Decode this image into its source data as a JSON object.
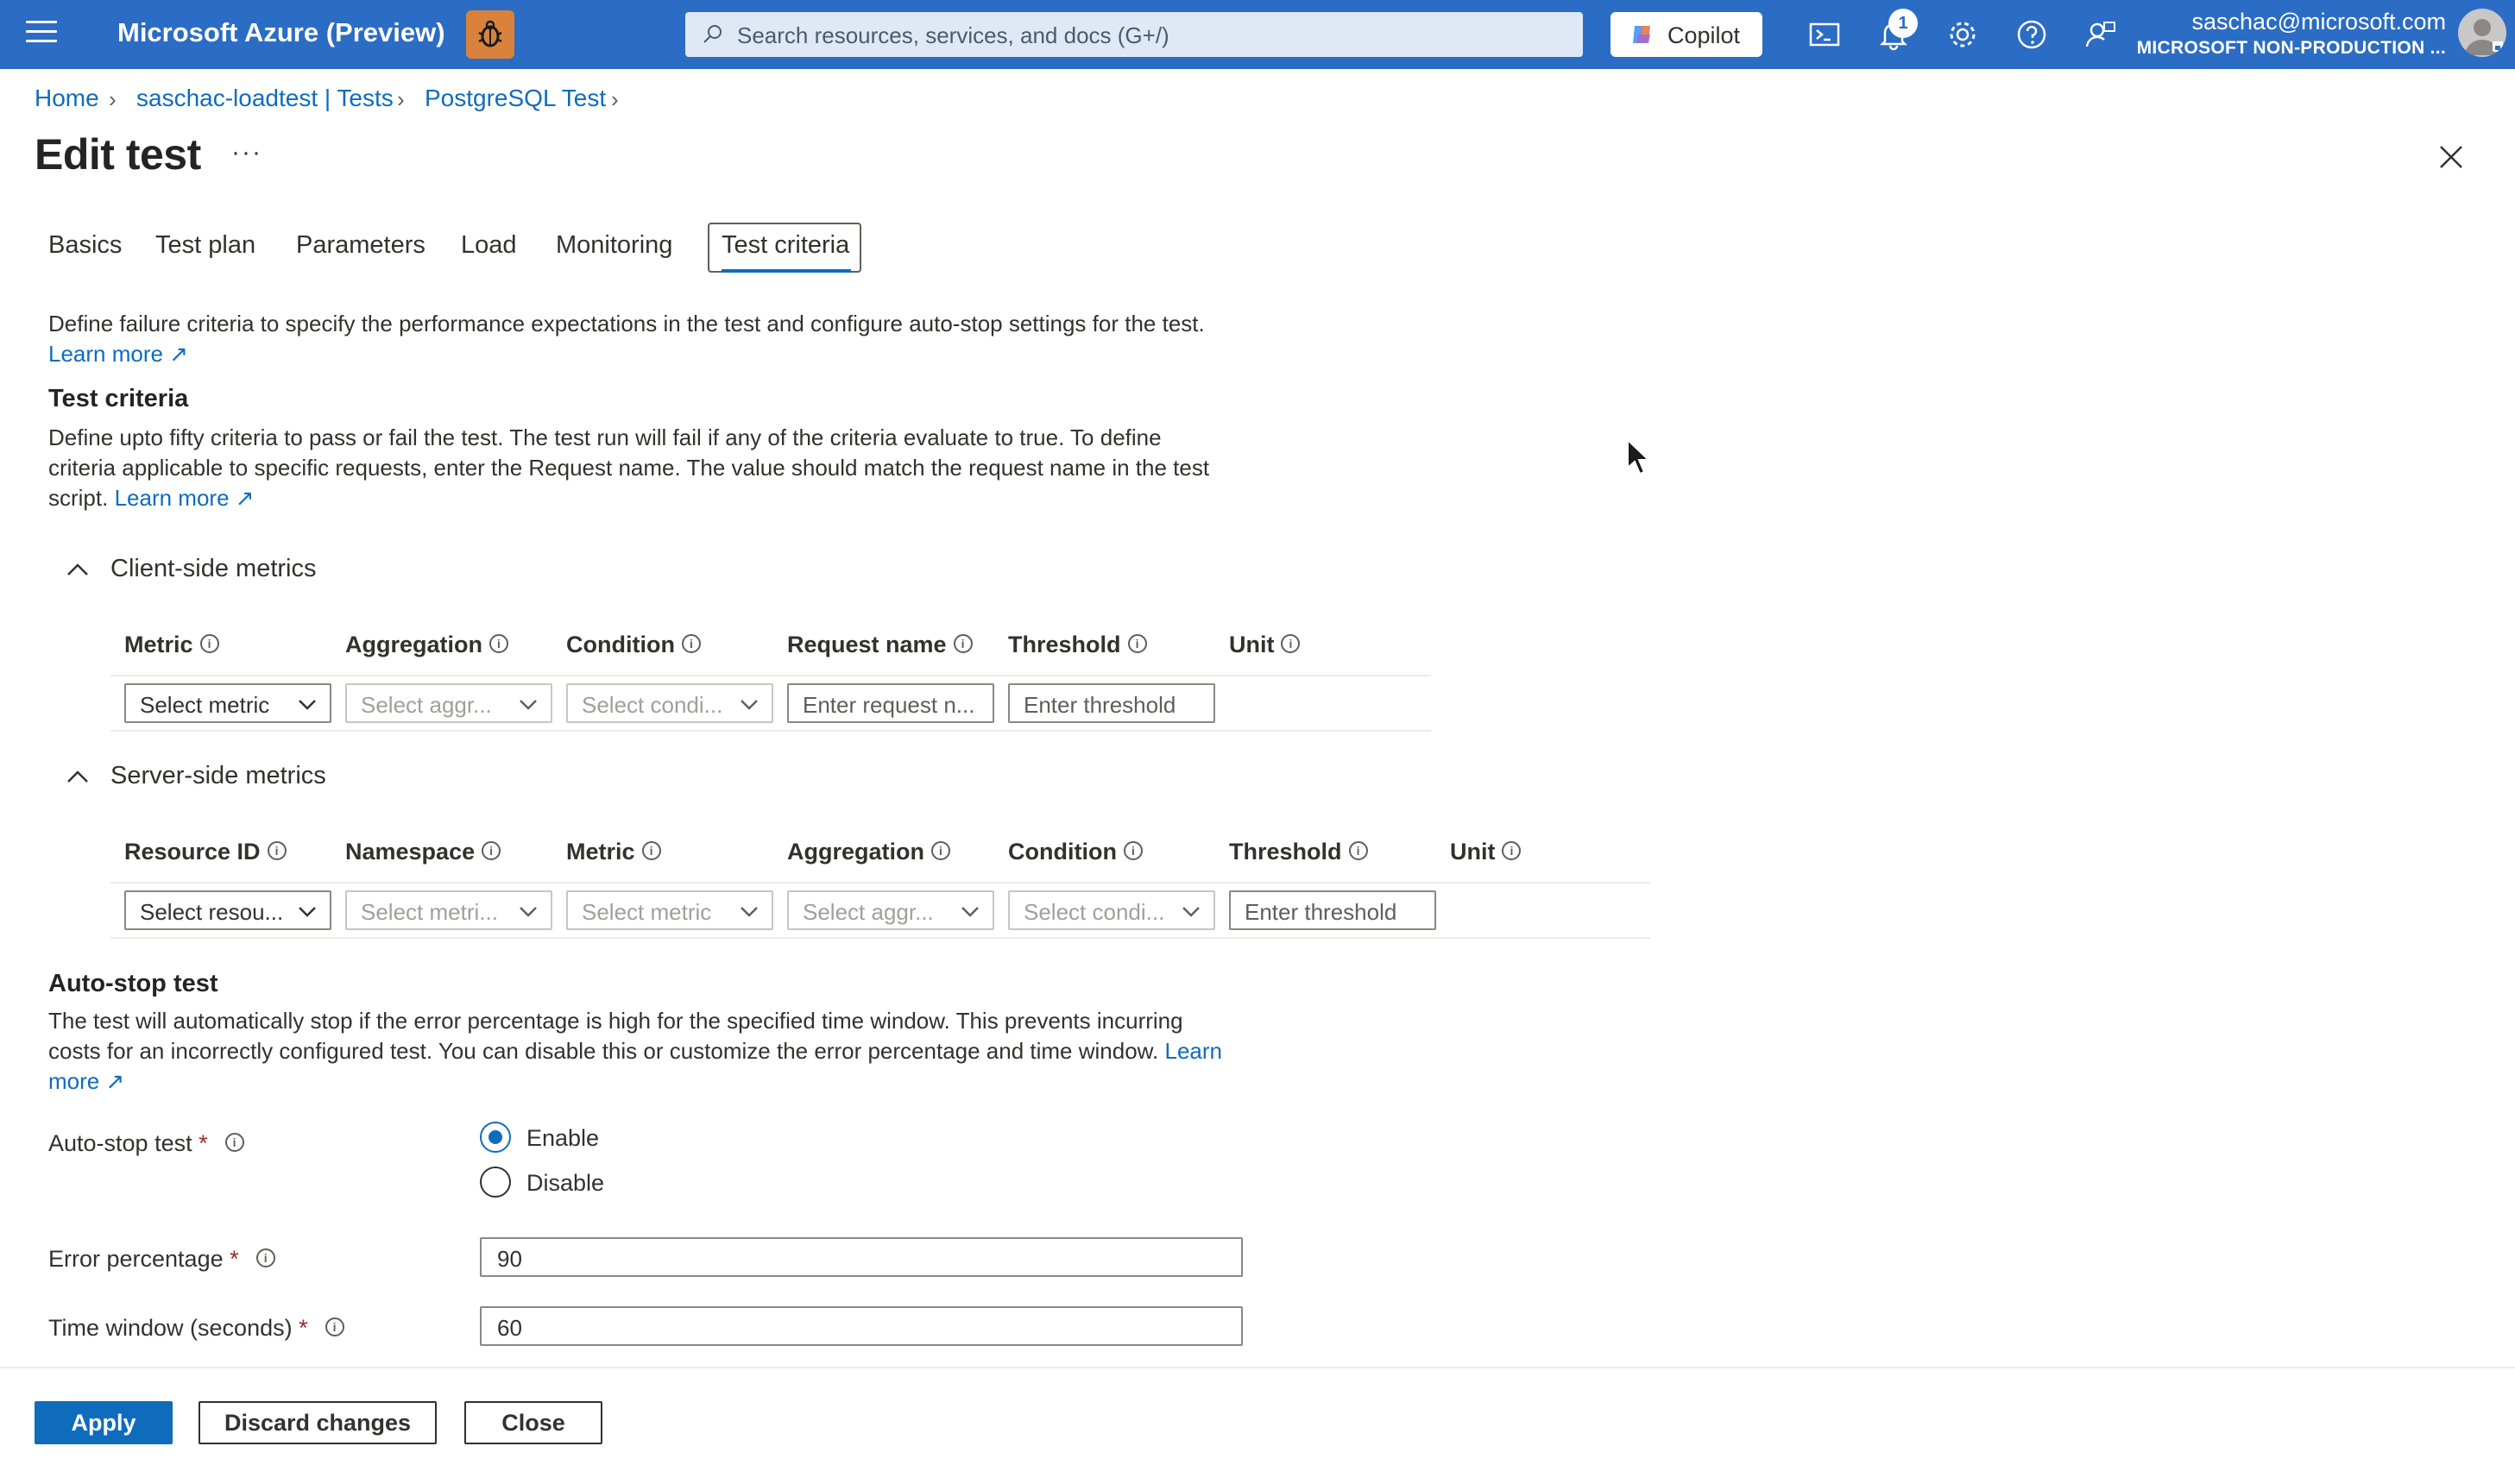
{
  "topbar": {
    "brand": "Microsoft Azure (Preview)",
    "search_placeholder": "Search resources, services, and docs (G+/)",
    "copilot_label": "Copilot",
    "notification_count": "1",
    "user_email": "saschac@microsoft.com",
    "user_org": "MICROSOFT NON-PRODUCTION ...",
    "icons": [
      "menu-icon",
      "bug-icon",
      "search-icon",
      "copilot-icon",
      "cloud-shell-icon",
      "bell-icon",
      "gear-icon",
      "help-icon",
      "feedback-icon"
    ]
  },
  "breadcrumb": [
    "Home",
    "saschac-loadtest | Tests",
    "PostgreSQL Test"
  ],
  "page": {
    "title": "Edit test",
    "more_label": "···"
  },
  "tabs": [
    "Basics",
    "Test plan",
    "Parameters",
    "Load",
    "Monitoring",
    "Test criteria"
  ],
  "active_tab": "Test criteria",
  "intro": {
    "text": "Define failure criteria to specify the performance expectations in the test and configure auto-stop settings for the test.",
    "learn_more": "Learn more"
  },
  "test_criteria": {
    "heading": "Test criteria",
    "text": "Define upto fifty criteria to pass or fail the test. The test run will fail if any of the criteria evaluate to true. To define criteria applicable to specific requests, enter the Request name. The value should match the request name in the test script.",
    "learn_more": "Learn more"
  },
  "client_side": {
    "heading": "Client-side metrics",
    "columns": [
      "Metric",
      "Aggregation",
      "Condition",
      "Request name",
      "Threshold",
      "Unit"
    ],
    "row": {
      "metric": "Select metric",
      "aggregation": "Select aggr...",
      "condition": "Select condi...",
      "request_name": "Enter request n...",
      "threshold": "Enter threshold"
    }
  },
  "server_side": {
    "heading": "Server-side metrics",
    "columns": [
      "Resource ID",
      "Namespace",
      "Metric",
      "Aggregation",
      "Condition",
      "Threshold",
      "Unit"
    ],
    "row": {
      "resource_id": "Select resou...",
      "namespace": "Select metri...",
      "metric": "Select metric",
      "aggregation": "Select aggr...",
      "condition": "Select condi...",
      "threshold": "Enter threshold"
    }
  },
  "auto_stop": {
    "heading": "Auto-stop test",
    "text": "The test will automatically stop if the error percentage is high for the specified time window. This prevents incurring costs for an incorrectly configured test. You can disable this or customize the error percentage and time window.",
    "learn_more_1": "Learn",
    "learn_more_2": "more",
    "label": "Auto-stop test",
    "options": [
      "Enable",
      "Disable"
    ],
    "selected": "Enable",
    "error_percentage_label": "Error percentage",
    "error_percentage_value": "90",
    "time_window_label": "Time window (seconds)",
    "time_window_value": "60",
    "required_mark": "*"
  },
  "footer": {
    "apply": "Apply",
    "discard": "Discard changes",
    "close": "Close"
  },
  "colors": {
    "topbar": "#2b6cc4",
    "link": "#0f6cbd",
    "primary_button": "#0f6cbd",
    "required": "#a4262c"
  }
}
